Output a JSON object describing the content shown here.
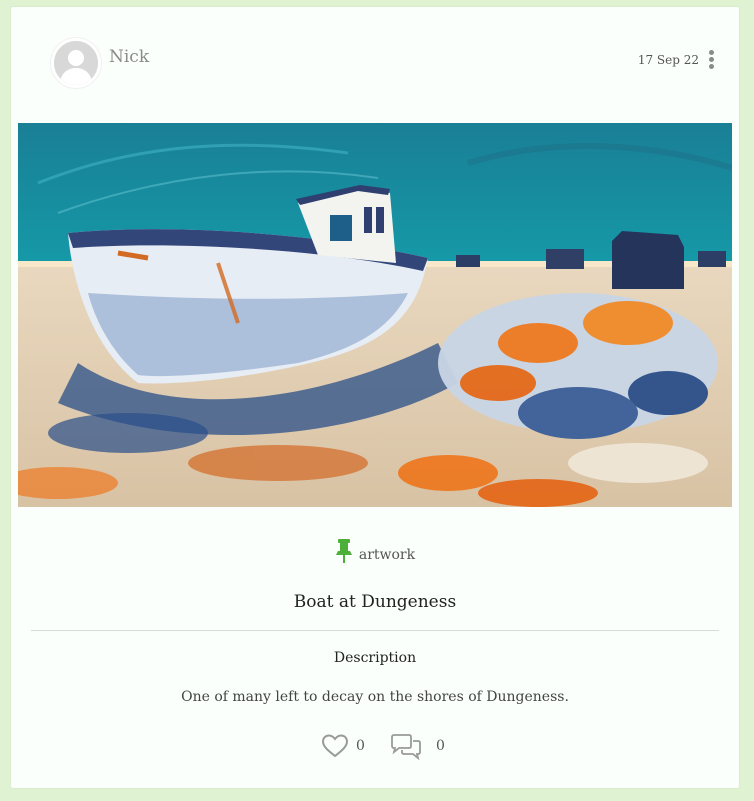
{
  "post": {
    "author": "Nick",
    "date": "17 Sep 22",
    "tag": "artwork",
    "title": "Boat at Dungeness",
    "description_label": "Description",
    "description": "One of many left to decay on the shores of Dungeness.",
    "likes": "0",
    "comments": "0"
  },
  "icons": {
    "avatar": "default-user-avatar",
    "menu": "vertical-dots-icon",
    "tag": "pushpin-icon",
    "like": "heart-outline-icon",
    "comment": "speech-bubbles-icon"
  },
  "colors": {
    "page_background": "#dff3d2",
    "card_background": "#fbfffb",
    "tag_icon": "#4caf3a"
  }
}
